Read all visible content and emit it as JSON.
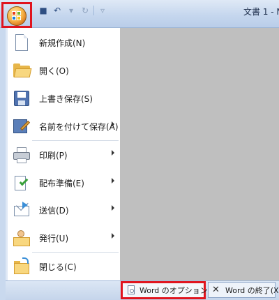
{
  "title_bar": {
    "document_title": "文書 1 - M",
    "qat": {
      "save_icon": "save-icon",
      "undo_icon": "undo-icon",
      "redo_icon": "redo-icon",
      "customize_icon": "customize-qat-icon"
    }
  },
  "office_button": {
    "icon": "office-logo-icon"
  },
  "menu": {
    "items": [
      {
        "label": "新規作成(N)",
        "icon": "new-document-icon",
        "has_submenu": false
      },
      {
        "label": "開く(O)",
        "icon": "open-folder-icon",
        "has_submenu": false
      },
      {
        "label": "上書き保存(S)",
        "icon": "save-disk-icon",
        "has_submenu": false
      },
      {
        "label": "名前を付けて保存(A)",
        "icon": "save-as-icon",
        "has_submenu": true
      },
      {
        "label": "印刷(P)",
        "icon": "printer-icon",
        "has_submenu": true
      },
      {
        "label": "配布準備(E)",
        "icon": "prepare-icon",
        "has_submenu": true
      },
      {
        "label": "送信(D)",
        "icon": "send-icon",
        "has_submenu": true
      },
      {
        "label": "発行(U)",
        "icon": "publish-icon",
        "has_submenu": true
      },
      {
        "label": "閉じる(C)",
        "icon": "close-folder-icon",
        "has_submenu": false
      }
    ]
  },
  "bottom_bar": {
    "options_label": "Word のオプション(I)",
    "exit_label": "Word の終了(X)"
  },
  "colors": {
    "highlight_border": "#e0141e",
    "recent_area": "#bfbfbf",
    "menu_background": "#ffffff"
  }
}
